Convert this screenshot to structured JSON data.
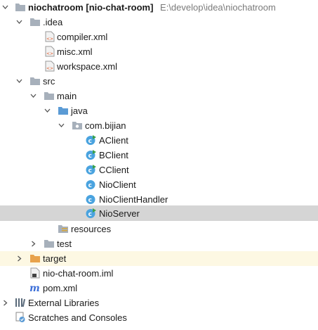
{
  "tree": {
    "root": {
      "name": "niochatroom",
      "module": "[nio-chat-room]",
      "path": "E:\\develop\\idea\\niochatroom"
    },
    "idea_folder": ".idea",
    "idea_files": [
      "compiler.xml",
      "misc.xml",
      "workspace.xml"
    ],
    "src_folder": "src",
    "main_folder": "main",
    "java_folder": "java",
    "package": "com.bijian",
    "classes": [
      "AClient",
      "BClient",
      "CClient",
      "NioClient",
      "NioClientHandler",
      "NioServer"
    ],
    "selected_class": "NioServer",
    "resources_folder": "resources",
    "test_folder": "test",
    "target_folder": "target",
    "iml_file": "nio-chat-room.iml",
    "pom_file": "pom.xml",
    "external_libraries": "External Libraries",
    "scratches": "Scratches and Consoles"
  },
  "icons": {
    "folder": "folder-icon",
    "source_folder": "source-folder-icon",
    "resources_folder": "resources-folder-icon",
    "excluded_folder": "excluded-folder-icon",
    "package": "package-icon",
    "xml": "xml-file-icon",
    "class": "java-class-icon",
    "runnable_class": "runnable-class-icon",
    "iml": "iml-file-icon",
    "maven": "maven-pom-icon",
    "libraries": "external-libraries-icon",
    "scratches": "scratches-icon"
  },
  "colors": {
    "selection": "#d5d5d5",
    "excluded_row": "#fdf8e3",
    "folder": "#a7b0bb",
    "source_folder": "#5b9bd5",
    "excluded_folder": "#e8a24b",
    "class_icon": "#4aa3df",
    "run_marker": "#3aa14a",
    "xml_icon": "#e05a2b",
    "maven": "#3c6fd8",
    "path_text": "#7a7a7a"
  }
}
